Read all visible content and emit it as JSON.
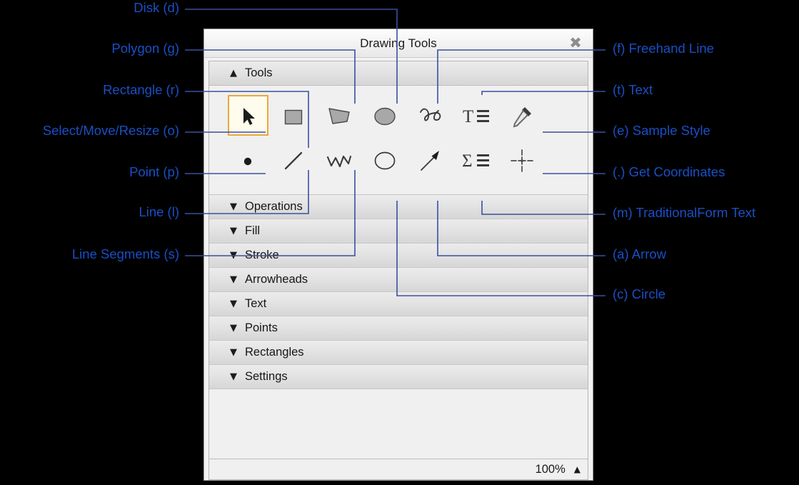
{
  "window": {
    "title": "Drawing Tools",
    "close_icon": "close-icon",
    "zoom_level": "100%",
    "zoom_caret_icon": "chevron-up-icon"
  },
  "tools_section": {
    "label": "Tools",
    "chevron_icon": "chevron-up-icon"
  },
  "tools": [
    {
      "name": "select-move-resize",
      "label": "Select/Move/Resize",
      "shortcut": "o",
      "icon": "cursor-arrow-icon",
      "selected": true,
      "row": 0,
      "col": 0
    },
    {
      "name": "rectangle",
      "label": "Rectangle",
      "shortcut": "r",
      "icon": "rectangle-icon",
      "selected": false,
      "row": 0,
      "col": 1
    },
    {
      "name": "polygon",
      "label": "Polygon",
      "shortcut": "g",
      "icon": "polygon-icon",
      "selected": false,
      "row": 0,
      "col": 2
    },
    {
      "name": "disk",
      "label": "Disk",
      "shortcut": "d",
      "icon": "disk-icon",
      "selected": false,
      "row": 0,
      "col": 3
    },
    {
      "name": "freehand-line",
      "label": "Freehand Line",
      "shortcut": "f",
      "icon": "freehand-line-icon",
      "selected": false,
      "row": 0,
      "col": 4
    },
    {
      "name": "text",
      "label": "Text",
      "shortcut": "t",
      "icon": "text-t-icon",
      "selected": false,
      "row": 0,
      "col": 5
    },
    {
      "name": "sample-style",
      "label": "Sample Style",
      "shortcut": "e",
      "icon": "eyedropper-icon",
      "selected": false,
      "row": 0,
      "col": 6
    },
    {
      "name": "point",
      "label": "Point",
      "shortcut": "p",
      "icon": "point-dot-icon",
      "selected": false,
      "row": 1,
      "col": 0
    },
    {
      "name": "line",
      "label": "Line",
      "shortcut": "l",
      "icon": "line-icon",
      "selected": false,
      "row": 1,
      "col": 1
    },
    {
      "name": "line-segments",
      "label": "Line Segments",
      "shortcut": "s",
      "icon": "line-segments-icon",
      "selected": false,
      "row": 1,
      "col": 2
    },
    {
      "name": "circle",
      "label": "Circle",
      "shortcut": "c",
      "icon": "circle-icon",
      "selected": false,
      "row": 1,
      "col": 3
    },
    {
      "name": "arrow",
      "label": "Arrow",
      "shortcut": "a",
      "icon": "arrow-icon",
      "selected": false,
      "row": 1,
      "col": 4
    },
    {
      "name": "traditionalform-text",
      "label": "TraditionalForm Text",
      "shortcut": "m",
      "icon": "sigma-text-icon",
      "selected": false,
      "row": 1,
      "col": 5
    },
    {
      "name": "get-coordinates",
      "label": "Get Coordinates",
      "shortcut": ".",
      "icon": "crosshair-icon",
      "selected": false,
      "row": 1,
      "col": 6
    }
  ],
  "sections": [
    {
      "label": "Operations",
      "chevron_icon": "chevron-down-icon"
    },
    {
      "label": "Fill",
      "chevron_icon": "chevron-down-icon"
    },
    {
      "label": "Stroke",
      "chevron_icon": "chevron-down-icon"
    },
    {
      "label": "Arrowheads",
      "chevron_icon": "chevron-down-icon"
    },
    {
      "label": "Text",
      "chevron_icon": "chevron-down-icon"
    },
    {
      "label": "Points",
      "chevron_icon": "chevron-down-icon"
    },
    {
      "label": "Rectangles",
      "chevron_icon": "chevron-down-icon"
    },
    {
      "label": "Settings",
      "chevron_icon": "chevron-down-icon"
    }
  ],
  "annotations": {
    "color": "#1a4fc4",
    "line_color": "#3b4fa0",
    "left": [
      {
        "name": "anno-disk",
        "text": "Disk (d)",
        "plain": "Disk",
        "key": "d"
      },
      {
        "name": "anno-polygon",
        "text": "Polygon (g)",
        "plain": "Polygon",
        "key": "g"
      },
      {
        "name": "anno-rectangle",
        "text": "Rectangle (r)",
        "plain": "Rectangle",
        "key": "r"
      },
      {
        "name": "anno-select-move-resize",
        "text": "Select/Move/Resize (o)",
        "plain": "Select/Move/Resize",
        "key": "o"
      },
      {
        "name": "anno-point",
        "text": "Point (p)",
        "plain": "Point",
        "key": "p"
      },
      {
        "name": "anno-line",
        "text": "Line (l)",
        "plain": "Line",
        "key": "l"
      },
      {
        "name": "anno-line-segments",
        "text": "Line Segments (s)",
        "plain": "Line Segments",
        "key": "s"
      }
    ],
    "right": [
      {
        "name": "anno-freehand-line",
        "text": "(f) Freehand Line",
        "key": "f",
        "plain": "Freehand Line"
      },
      {
        "name": "anno-text",
        "text": "(t) Text",
        "key": "t",
        "plain": "Text"
      },
      {
        "name": "anno-sample-style",
        "text": "(e) Sample Style",
        "key": "e",
        "plain": "Sample Style"
      },
      {
        "name": "anno-get-coordinates",
        "text": "(.) Get Coordinates",
        "key": ".",
        "plain": "Get Coordinates"
      },
      {
        "name": "anno-traditionalform-text",
        "text": "(m) TraditionalForm Text",
        "key": "m",
        "plain": "TraditionalForm Text"
      },
      {
        "name": "anno-arrow",
        "text": "(a) Arrow",
        "key": "a",
        "plain": "Arrow"
      },
      {
        "name": "anno-circle",
        "text": "(c) Circle",
        "key": "c",
        "plain": "Circle"
      }
    ]
  }
}
